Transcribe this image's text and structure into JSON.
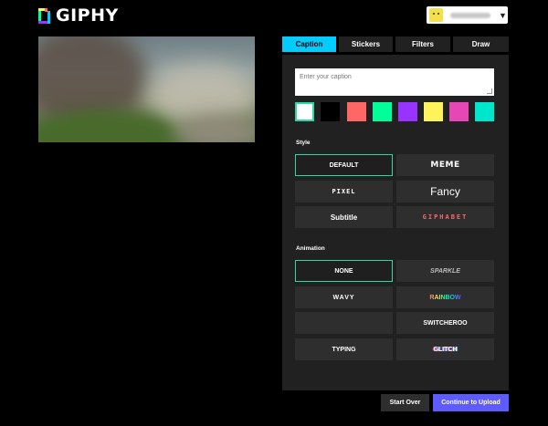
{
  "header": {
    "logo_text": "GIPHY",
    "logo_colors": [
      "#00ff99",
      "#9933ff",
      "#00ccff",
      "#fff35c",
      "#ff6666"
    ],
    "user_menu_icon": "chevron-down-icon"
  },
  "tabs": [
    {
      "label": "Caption",
      "active": true
    },
    {
      "label": "Stickers",
      "active": false
    },
    {
      "label": "Filters",
      "active": false
    },
    {
      "label": "Draw",
      "active": false
    }
  ],
  "caption": {
    "placeholder": "Enter your caption",
    "value": ""
  },
  "colors": [
    "#ffffff",
    "#000000",
    "#ff6666",
    "#00ff99",
    "#9933ff",
    "#fff35c",
    "#e646b6",
    "#00e6cc"
  ],
  "selected_color_index": 0,
  "style_section": {
    "label": "Style",
    "options": [
      "DEFAULT",
      "MEME",
      "PIXEL",
      "Fancy",
      "Subtitle",
      "GIPHABET"
    ],
    "selected": "DEFAULT"
  },
  "animation_section": {
    "label": "Animation",
    "options": [
      "NONE",
      "SPARKLE",
      "WAVY",
      "RAINBOW",
      "",
      "SWITCHEROO",
      "TYPING",
      "GLITCH"
    ],
    "selected": "NONE"
  },
  "footer": {
    "start_over": "Start Over",
    "continue": "Continue to Upload"
  },
  "accent_colors": {
    "caption_tab": "#00ccff",
    "selection_border": "#2fd7a5",
    "continue_button": "#5f5cff"
  }
}
